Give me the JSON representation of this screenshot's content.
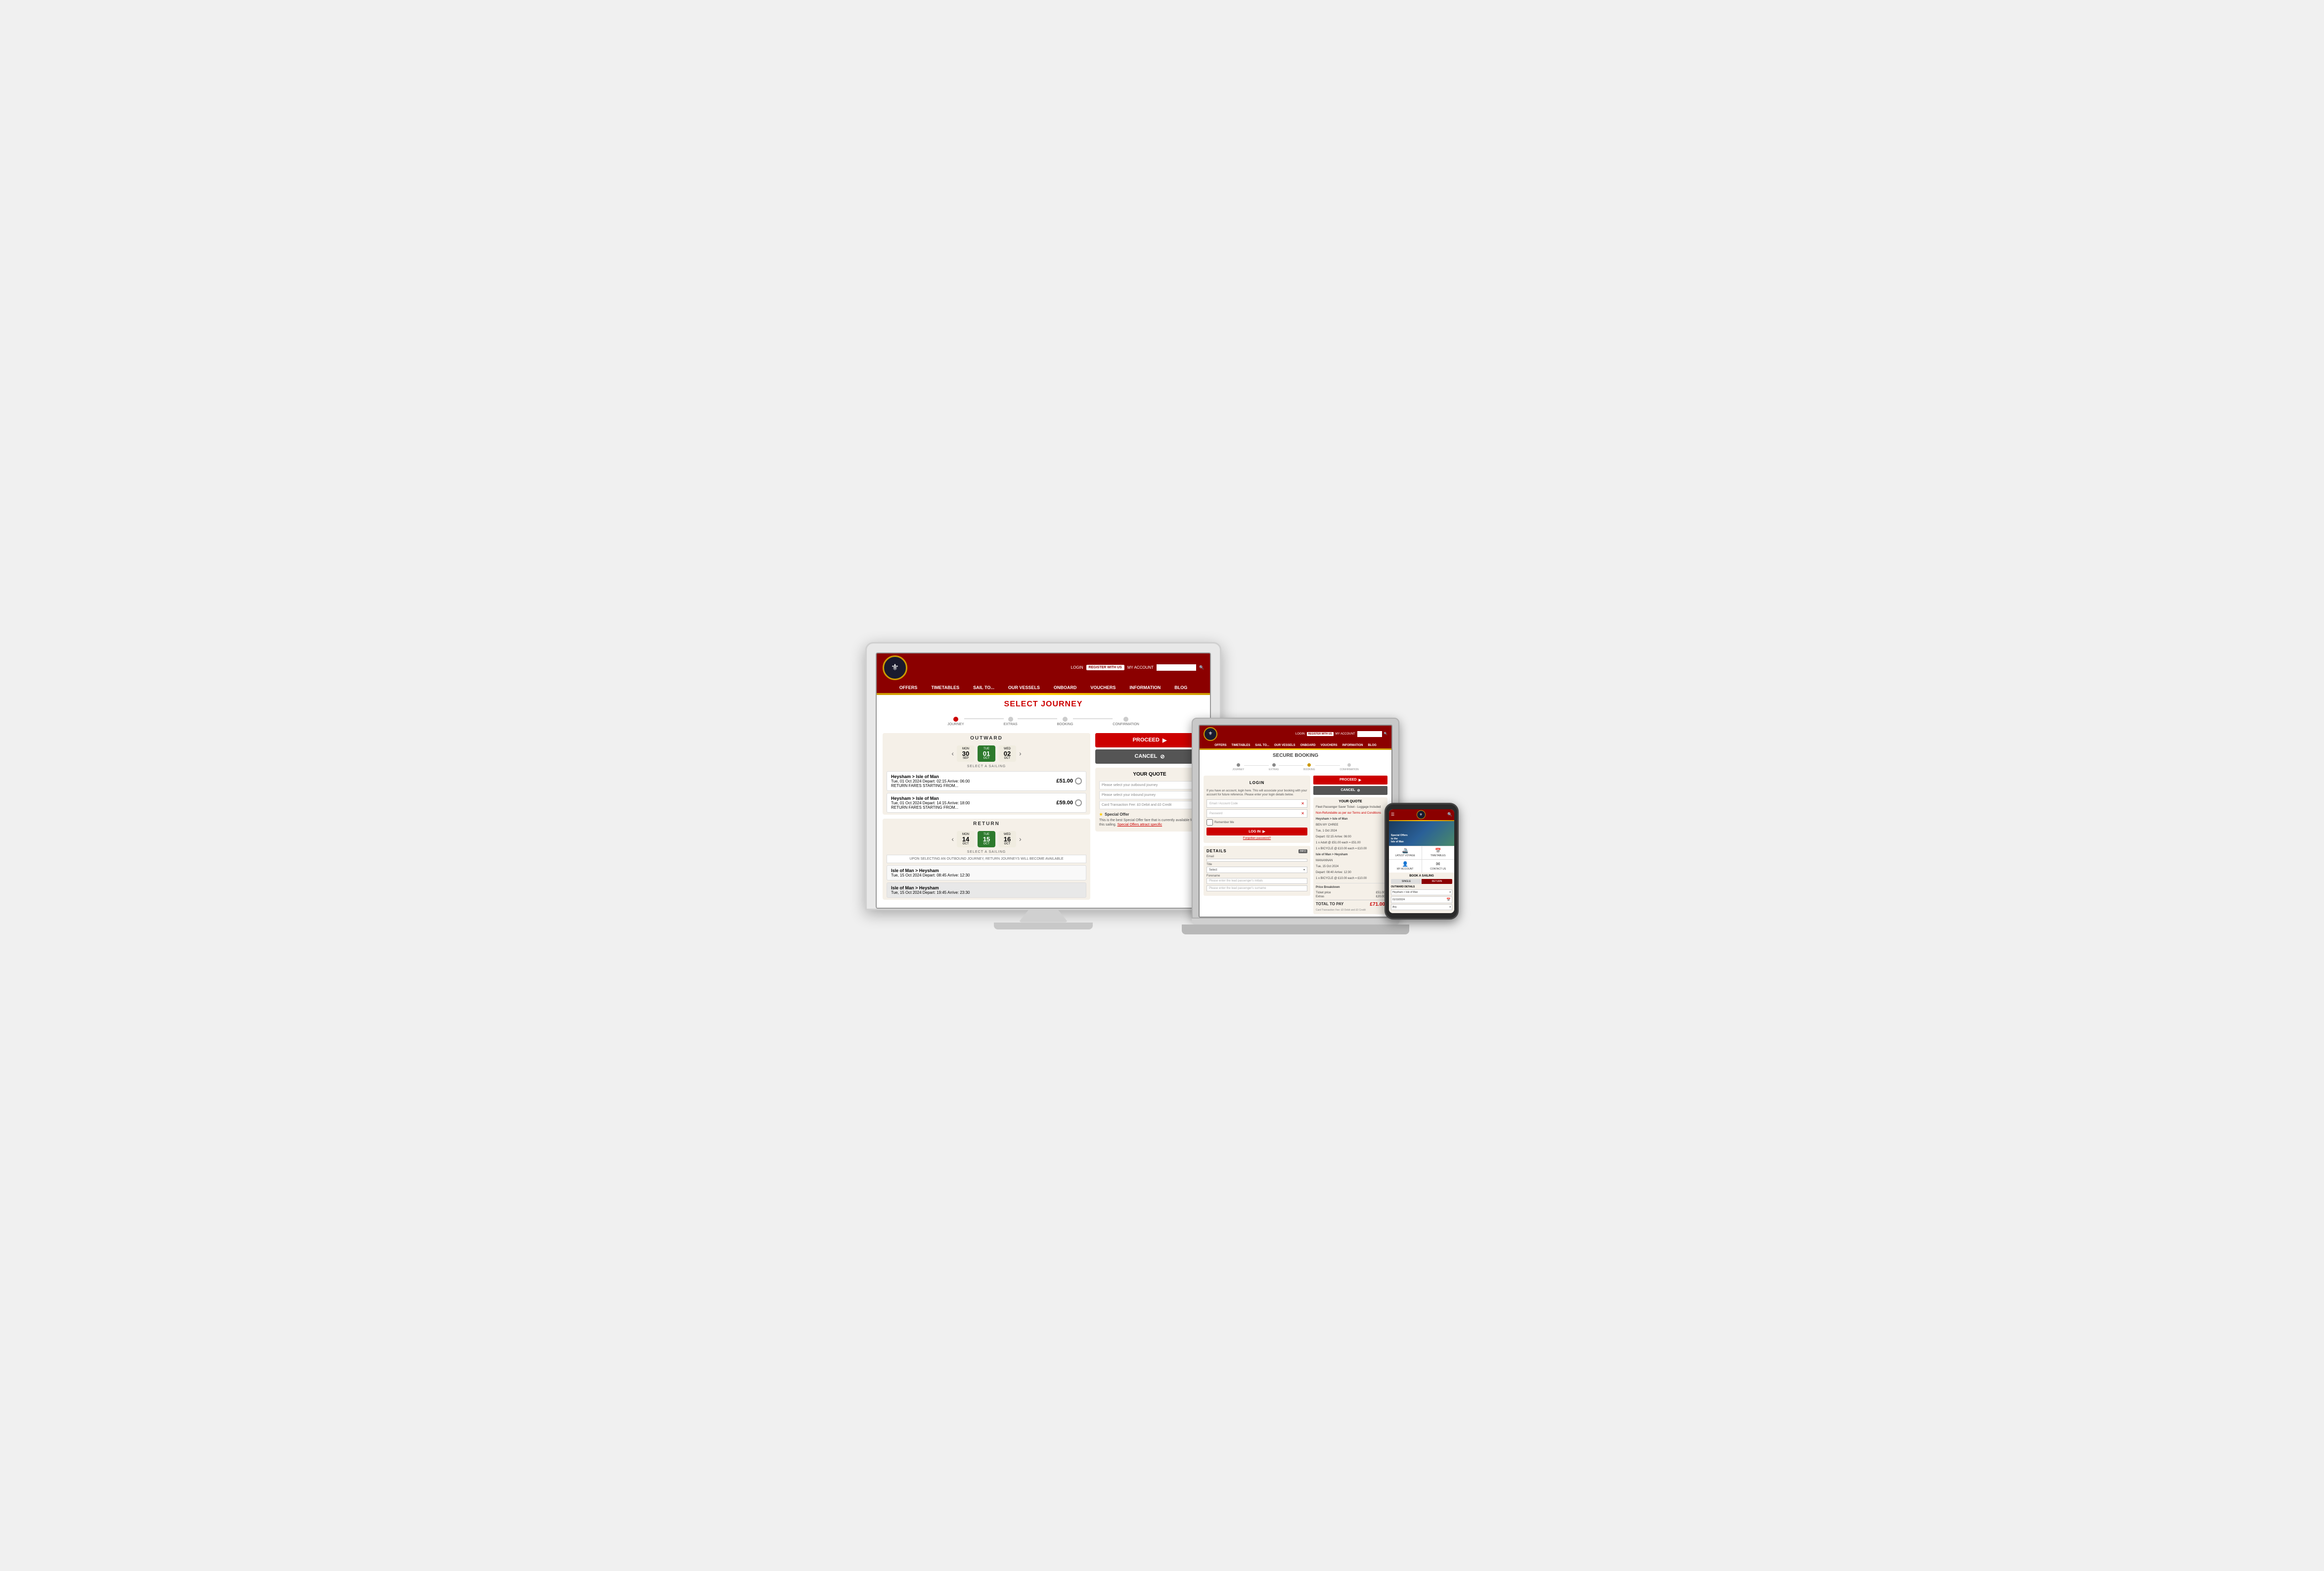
{
  "scene": {
    "background_color": "#f0f0f0"
  },
  "monitor": {
    "site": {
      "nav_items": [
        "OFFERS",
        "TIMETABLES",
        "SAIL TO...",
        "OUR VESSELS",
        "ONBOARD",
        "VOUCHERS",
        "INFORMATION",
        "BLOG"
      ],
      "login_label": "LOGIN",
      "register_label": "REGISTER WITH US",
      "account_label": "MY ACCOUNT",
      "page_title": "SELECT JOURNEY",
      "steps": [
        "JOURNEY",
        "EXTRAS",
        "BOOKING",
        "CONFIRMATION"
      ],
      "outward_title": "OUTWARD",
      "dates_outward": [
        {
          "day": "MON",
          "num": "30",
          "month": "SEP"
        },
        {
          "day": "TUE",
          "num": "01",
          "month": "OCT"
        },
        {
          "day": "WED",
          "num": "02",
          "month": "OCT"
        }
      ],
      "selected_outward": 1,
      "select_sailing_label": "SELECT A SAILING",
      "sailings_outward": [
        {
          "route": "Heysham > Isle of Man",
          "details": "Tue, 01 Oct 2024  Depart: 02:15 Arrive: 06:00",
          "note": "RETURN FARES STARTING FROM...",
          "price": "£51.00"
        },
        {
          "route": "Heysham > Isle of Man",
          "details": "Tue, 01 Oct 2024  Depart: 14:15 Arrive: 18:00",
          "note": "RETURN FARES STARTING FROM...",
          "price": "£59.00"
        }
      ],
      "return_title": "RETURN",
      "dates_return": [
        {
          "day": "MON",
          "num": "14",
          "month": "OCT"
        },
        {
          "day": "TUE",
          "num": "15",
          "month": "OCT"
        },
        {
          "day": "WED",
          "num": "16",
          "month": "OCT"
        }
      ],
      "selected_return": 1,
      "upon_notice": "UPON SELECTING AN OUTBOUND JOURNEY, RETURN JOURNEYS WILL BECOME AVAILABLE",
      "sailings_return": [
        {
          "route": "Isle of Man > Heysham",
          "details": "Tue, 15 Oct 2024  Depart: 08:45 Arrive: 12:30"
        },
        {
          "route": "Isle of Man > Heysham",
          "details": "Tue, 15 Oct 2024  Depart: 19:45 Arrive: 23:30"
        }
      ],
      "proceed_label": "PROCEED",
      "cancel_label": "CANCEL",
      "your_quote_title": "YOUR QUOTE",
      "quote_lines": [
        "Please select your outbound journey",
        "Please select your inbound journey",
        "Card Transaction Fee: £0 Debit and £0 Credit"
      ],
      "special_offer_label": "Special Offer",
      "special_offer_text": "This is the best Special Offer fare that is currently available for this sailing.",
      "special_offer_link": "Special Offers attract specific"
    }
  },
  "laptop": {
    "site": {
      "nav_items": [
        "OFFERS",
        "TIMETABLES",
        "SAIL TO...",
        "OUR VESSELS",
        "ONBOARD",
        "VOUCHERS",
        "INFORMATION",
        "BLOG"
      ],
      "login_label": "LOGIN",
      "register_label": "REGISTER WITH US",
      "account_label": "MY ACCOUNT",
      "page_title": "SECURE BOOKING",
      "steps": [
        "JOURNEY",
        "EXTRAS",
        "BOOKING",
        "CONFIRMATION"
      ],
      "login_section_title": "LOGIN",
      "login_desc": "If you have an account, login here. This will associate your booking with your account for future reference. Please enter your login details below.",
      "email_placeholder": "Email / Account Code",
      "password_placeholder": "Password",
      "remember_me_label": "Remember Me",
      "login_btn_label": "LOG IN",
      "forgot_password_label": "Forgotten password?",
      "details_title": "DETAILS",
      "fields": {
        "email_label": "Email",
        "title_label": "Title",
        "title_placeholder": "Select",
        "forename_label": "Forename",
        "forename_placeholder": "Please enter the lead passenger's initials",
        "surname_placeholder": "Please enter the lead passenger's surname"
      },
      "proceed_label": "PROCEED",
      "cancel_label": "CANCEL",
      "your_quote_title": "YOUR QUOTE",
      "ticket_type": "Fleet Passenger Saver Ticket - Luggage Included",
      "non_refundable_note": "Non-Refundable as per our Terms and Conditions",
      "outward_route": "Heysham > Isle of Man",
      "outward_vessel": "BEN MY CHREE",
      "outward_date": "Tue, 1 Oct 2024",
      "outward_depart": "Depart: 02:15 Arrive: 06:00",
      "outward_adult": "1 x Adult @ £51.00 each = £51.00",
      "outward_bicycle": "1 x BICYCLE @ £10.00 each = £10.00",
      "return_route": "Isle of Man > Heysham",
      "return_vessel": "MANANNAN",
      "return_date": "Tue, 15 Oct 2024",
      "return_depart": "Depart: 08:40 Arrive: 12:30",
      "return_adult": "Ticket price",
      "return_bicycle": "1 x BICYCLE @ £10.00 each = £10.00",
      "price_breakdown_label": "Price Breakdown",
      "ticket_price_label": "Ticket price",
      "ticket_price_value": "£51.00",
      "extras_label": "Extras",
      "extras_value": "£20.00",
      "total_label": "TOTAL TO PAY",
      "total_value": "£71.00",
      "card_note": "Card Transaction Fee: £0 Debit and £0 Credit"
    }
  },
  "phone": {
    "site": {
      "menu_label": "☰",
      "search_label": "🔍",
      "hero_text": "Special Offers\nto the\nIsle of Man",
      "quick_links": [
        {
          "icon": "🚢",
          "label": "LATEST VOYAGE"
        },
        {
          "icon": "📅",
          "label": "TIMETABLES"
        },
        {
          "icon": "👤",
          "label": "MY ACCOUNT"
        },
        {
          "icon": "✉",
          "label": "CONTACT US"
        }
      ],
      "book_title": "BOOK A SAILING",
      "toggle_single": "SINGLE",
      "toggle_return": "RETURN",
      "outward_title": "OUTWARD DETAILS",
      "route_label": "Heysham > Isle of Man",
      "date_value": "01/10/2024",
      "time_label": "Any"
    }
  }
}
